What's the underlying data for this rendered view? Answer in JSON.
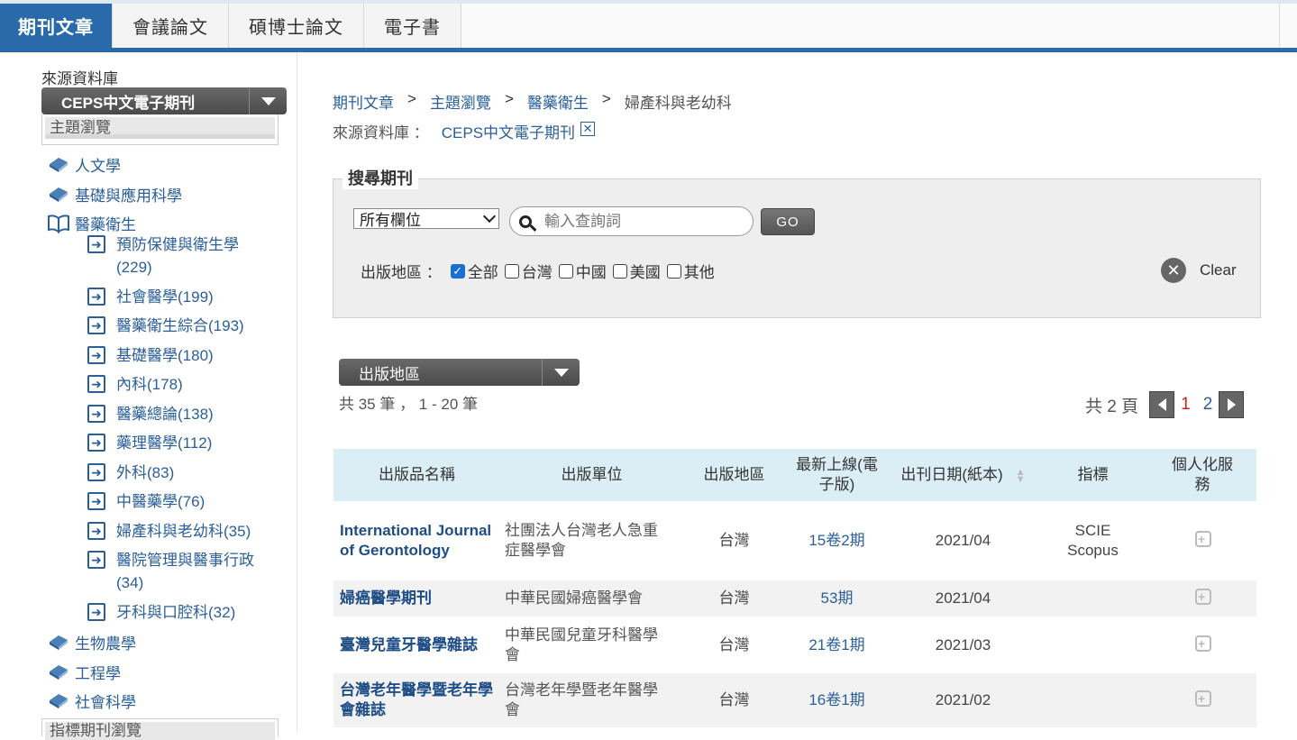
{
  "tabs": [
    {
      "label": "期刊文章",
      "active": true
    },
    {
      "label": "會議論文",
      "active": false
    },
    {
      "label": "碩博士論文",
      "active": false
    },
    {
      "label": "電子書",
      "active": false
    }
  ],
  "sidebar": {
    "source_label": "來源資料庫",
    "source_value": "CEPS中文電子期刊",
    "browse_title": "主題瀏覽",
    "categories": [
      {
        "label": "人文學"
      },
      {
        "label": "基礎與應用科學"
      },
      {
        "label": "醫藥衛生"
      },
      {
        "label": "生物農學"
      },
      {
        "label": "工程學"
      },
      {
        "label": "社會科學"
      }
    ],
    "subcategories": [
      {
        "line1": "預防保健與衛生學",
        "line2": "(229)"
      },
      {
        "line1": "社會醫學(199)",
        "line2": ""
      },
      {
        "line1": "醫藥衛生綜合(193)",
        "line2": ""
      },
      {
        "line1": "基礎醫學(180)",
        "line2": ""
      },
      {
        "line1": "內科(178)",
        "line2": ""
      },
      {
        "line1": "醫藥總論(138)",
        "line2": ""
      },
      {
        "line1": "藥理醫學(112)",
        "line2": ""
      },
      {
        "line1": "外科(83)",
        "line2": ""
      },
      {
        "line1": "中醫藥學(76)",
        "line2": ""
      },
      {
        "line1": "婦產科與老幼科(35)",
        "line2": ""
      },
      {
        "line1": "醫院管理與醫事行政",
        "line2": "(34)"
      },
      {
        "line1": "牙科與口腔科(32)",
        "line2": ""
      }
    ],
    "indicator_title": "指標期刊瀏覽"
  },
  "breadcrumb": [
    "期刊文章",
    "主題瀏覽",
    "醫藥衛生",
    "婦產科與老幼科"
  ],
  "breadcrumb_sep": ">",
  "source_filter": {
    "label": "來源資料庫 ：",
    "value": "CEPS中文電子期刊",
    "remove": "✕"
  },
  "search": {
    "legend": "搜尋期刊",
    "field": "所有欄位",
    "placeholder": "輸入查詢詞",
    "go": "GO",
    "region_label": "出版地區 ：",
    "regions": [
      {
        "label": "全部",
        "checked": true
      },
      {
        "label": "台灣",
        "checked": false
      },
      {
        "label": "中國",
        "checked": false
      },
      {
        "label": "美國",
        "checked": false
      },
      {
        "label": "其他",
        "checked": false
      }
    ],
    "clear": "Clear"
  },
  "sort_select": "出版地區",
  "result_count": "共 35 筆 ， 1 - 20 筆",
  "pager": {
    "total": "共 2 頁",
    "pages": [
      "1",
      "2"
    ],
    "current": "1"
  },
  "table": {
    "headers": [
      "出版品名稱",
      "出版單位",
      "出版地區",
      "最新上線(電子版)",
      "出刊日期(紙本)",
      "指標",
      "個人化服務"
    ],
    "rows": [
      {
        "name": "International Journal of Gerontology",
        "publisher": "社團法人台灣老人急重症醫學會",
        "region": "台灣",
        "issue": "15卷2期",
        "date": "2021/04",
        "index": "SCIE Scopus"
      },
      {
        "name": "婦癌醫學期刊",
        "publisher": "中華民國婦癌醫學會",
        "region": "台灣",
        "issue": "53期",
        "date": "2021/04",
        "index": ""
      },
      {
        "name": "臺灣兒童牙醫學雜誌",
        "publisher": "中華民國兒童牙科醫學會",
        "region": "台灣",
        "issue": "21卷1期",
        "date": "2021/03",
        "index": ""
      },
      {
        "name": "台灣老年醫學暨老年學會雜誌",
        "publisher": "台灣老年學暨老年醫學會",
        "region": "台灣",
        "issue": "16卷1期",
        "date": "2021/02",
        "index": ""
      }
    ]
  },
  "colors": {
    "accent": "#2a6aaa",
    "link": "#2a5f9a",
    "header_bg": "#dbeef6"
  }
}
